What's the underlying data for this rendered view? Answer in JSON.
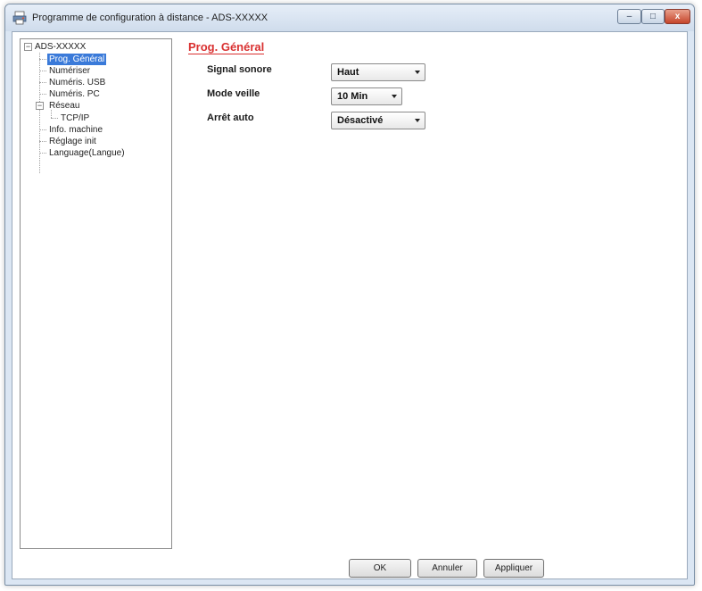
{
  "window": {
    "title": "Programme de configuration à distance - ADS-XXXXX",
    "controls": {
      "minimize": "–",
      "maximize": "□",
      "close": "x"
    }
  },
  "tree": {
    "root": "ADS-XXXXX",
    "items": [
      {
        "label": "Prog. Général",
        "selected": true
      },
      {
        "label": "Numériser"
      },
      {
        "label": "Numéris. USB"
      },
      {
        "label": "Numéris. PC"
      },
      {
        "label": "Réseau"
      },
      {
        "label": "TCP/IP"
      },
      {
        "label": "Info. machine"
      },
      {
        "label": "Réglage init"
      },
      {
        "label": "Language(Langue)"
      }
    ],
    "expander_root": "−",
    "expander_reseau": "−"
  },
  "panel": {
    "title": "Prog. Général",
    "fields": [
      {
        "label": "Signal sonore",
        "value": "Haut"
      },
      {
        "label": "Mode veille",
        "value": "10 Min"
      },
      {
        "label": "Arrêt auto",
        "value": "Désactivé"
      }
    ]
  },
  "buttons": {
    "ok": "OK",
    "cancel": "Annuler",
    "apply": "Appliquer"
  },
  "colors": {
    "selection": "#3a7ad9",
    "section_title": "#d93030",
    "close_button": "#c5452a"
  },
  "icons": {
    "app": "printer-icon",
    "combo": "chevron-down-icon"
  }
}
